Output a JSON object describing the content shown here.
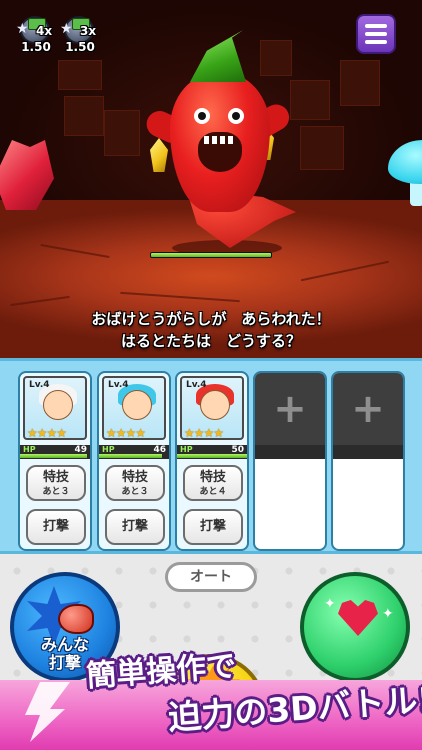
{
  "hud": {
    "speed_badges": [
      {
        "multiplier": "4x",
        "value": "1.50",
        "icon": "star-box-icon"
      },
      {
        "multiplier": "3x",
        "value": "1.50",
        "icon": "star-box-icon"
      }
    ],
    "menu_icon": "hamburger-menu-icon"
  },
  "enemy": {
    "name_icon": "chili-ghost-monster",
    "hp_fraction": 1.0
  },
  "message": {
    "line1": "おばけとうがらしが　あらわれた！",
    "line2": "はるとたちは　どうする？"
  },
  "party": [
    {
      "level": "Lv.4",
      "stars": "★★★★",
      "hp_label": "HP",
      "hp": "49",
      "hp_fraction": 0.95,
      "hair_color": "#f5f5f5",
      "skill_label": "特技",
      "skill_sub": "あと３",
      "attack_label": "打撃"
    },
    {
      "level": "Lv.4",
      "stars": "★★★★",
      "hp_label": "HP",
      "hp": "46",
      "hp_fraction": 0.9,
      "hair_color": "#3ec7e8",
      "skill_label": "特技",
      "skill_sub": "あと３",
      "attack_label": "打撃"
    },
    {
      "level": "Lv.4",
      "stars": "★★★★",
      "hp_label": "HP",
      "hp": "50",
      "hp_fraction": 1.0,
      "hair_color": "#e8322a",
      "skill_label": "特技",
      "skill_sub": "あと４",
      "attack_label": "打撃"
    }
  ],
  "empty_slots": [
    {
      "icon": "plus-icon",
      "symbol": "+"
    },
    {
      "icon": "plus-icon",
      "symbol": "+"
    }
  ],
  "actions": {
    "auto_label": "オート",
    "all_attack_line1": "みんな",
    "all_attack_line2": "打撃"
  },
  "promo": {
    "line1": "簡単操作で",
    "line2": "迫力の3Dバトル!"
  },
  "colors": {
    "party_bg": "#8fd7f2",
    "accent_purple": "#6c34b8",
    "promo_pink": "#ee64c4"
  }
}
